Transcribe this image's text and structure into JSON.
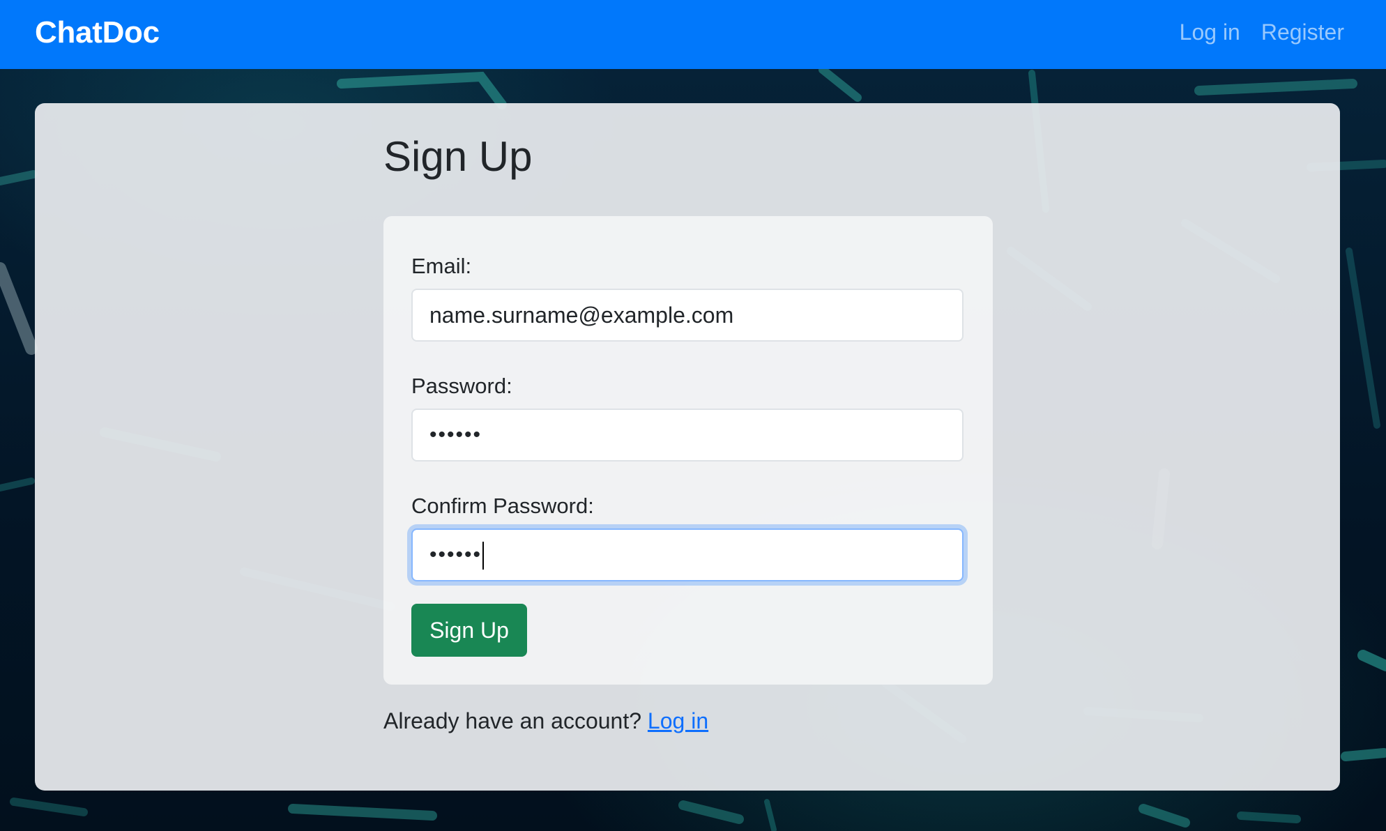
{
  "navbar": {
    "brand": "ChatDoc",
    "links": [
      "Log in",
      "Register"
    ],
    "color": "#0178fb"
  },
  "page": {
    "title": "Sign Up"
  },
  "form": {
    "email_label": "Email:",
    "email_value": "name.surname@example.com",
    "password_label": "Password:",
    "password_value": "••••••",
    "confirm_label": "Confirm Password:",
    "confirm_value": "••••••",
    "submit_label": "Sign Up",
    "submit_color": "#198754"
  },
  "footer": {
    "prompt": "Already have an account?",
    "link_label": "Log in"
  }
}
